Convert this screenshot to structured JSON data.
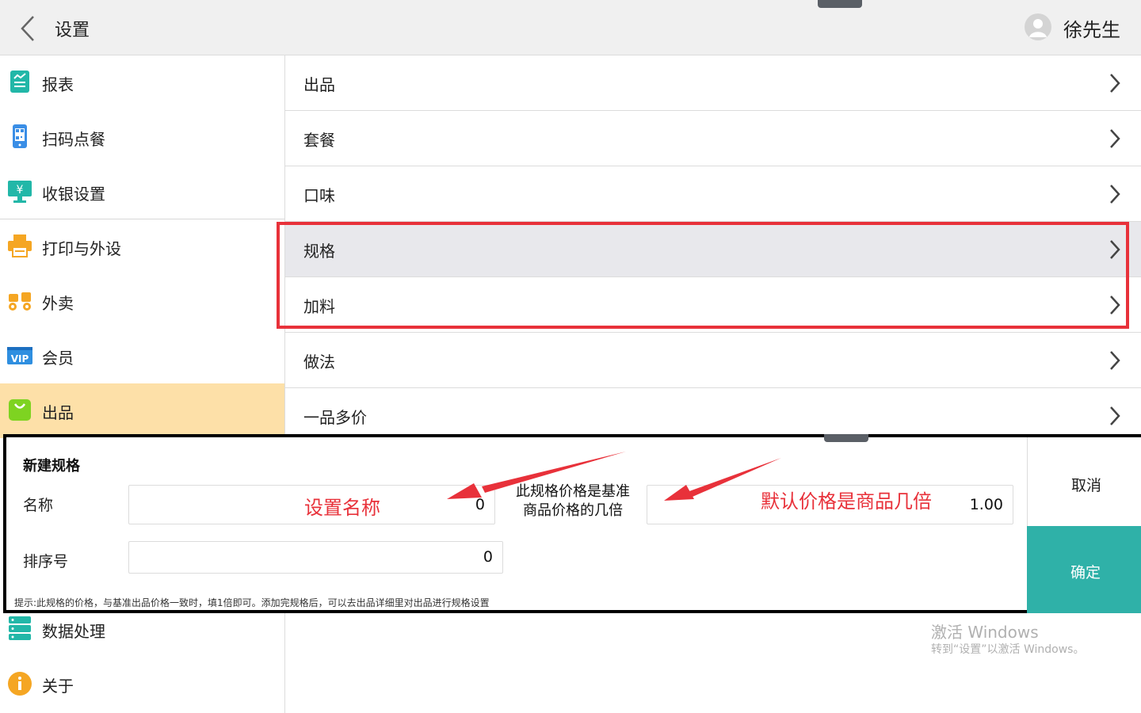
{
  "header": {
    "title": "设置",
    "user_name": "徐先生"
  },
  "sidebar": {
    "items": [
      {
        "label": "报表",
        "icon": "report-icon"
      },
      {
        "label": "扫码点餐",
        "icon": "qr-phone-icon"
      },
      {
        "label": "收银设置",
        "icon": "cashier-icon"
      },
      {
        "label": "打印与外设",
        "icon": "printer-icon"
      },
      {
        "label": "外卖",
        "icon": "delivery-icon"
      },
      {
        "label": "会员",
        "icon": "vip-icon"
      },
      {
        "label": "出品",
        "icon": "bag-icon",
        "active": true
      },
      {
        "label": "数据处理",
        "icon": "database-icon"
      },
      {
        "label": "关于",
        "icon": "info-icon"
      }
    ]
  },
  "list": {
    "items": [
      {
        "label": "出品"
      },
      {
        "label": "套餐"
      },
      {
        "label": "口味"
      },
      {
        "label": "规格",
        "selected": true
      },
      {
        "label": "加料"
      },
      {
        "label": "做法"
      },
      {
        "label": "一品多价"
      }
    ]
  },
  "dialog": {
    "title": "新建规格",
    "name_label": "名称",
    "name_value": "0",
    "multiplier_label_line1": "此规格价格是基准",
    "multiplier_label_line2": "商品价格的几倍",
    "multiplier_value": "1.00",
    "sort_label": "排序号",
    "sort_value": "0",
    "hint": "提示:此规格的价格，与基准出品价格一致时，填1倍即可。添加完规格后，可以去出品详细里对出品进行规格设置",
    "cancel_label": "取消",
    "confirm_label": "确定"
  },
  "annotations": {
    "name_note": "设置名称",
    "price_note": "默认价格是商品几倍"
  },
  "watermark": {
    "line1": "激活 Windows",
    "line2": "转到“设置”以激活 Windows。"
  },
  "colors": {
    "accent": "#2fb1a8",
    "active_bg": "#fde0a8",
    "annotation": "#e8313a"
  }
}
